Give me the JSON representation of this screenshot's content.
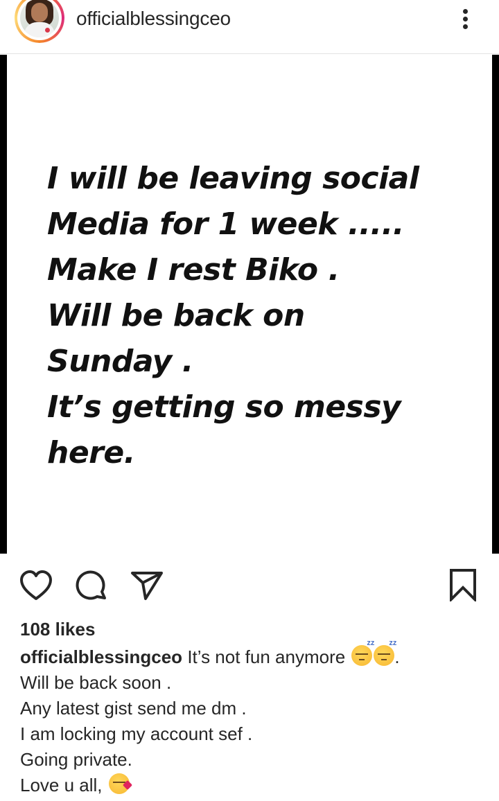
{
  "header": {
    "username": "officialblessingceo",
    "more_icon": "more-vertical-icon"
  },
  "post": {
    "lines": [
      "I will be leaving social",
      "Media for 1 week .....",
      "Make I rest Biko .",
      "Will be back on",
      "Sunday .",
      "It’s getting so messy",
      "here."
    ]
  },
  "actions": {
    "like_icon": "heart-outline-icon",
    "comment_icon": "comment-bubble-icon",
    "share_icon": "paper-plane-icon",
    "save_icon": "bookmark-icon"
  },
  "likes": "108 likes",
  "caption": {
    "username": "officialblessingceo",
    "first_line": "It’s not fun anymore",
    "first_line_end": ".",
    "lines": [
      "Will be back soon .",
      "Any latest gist send me dm .",
      "I am locking my account sef .",
      "Going private.",
      "Love u all,"
    ],
    "emojis": [
      "sleeping-face-emoji",
      "sleeping-face-emoji",
      "face-blowing-kiss-emoji"
    ]
  }
}
